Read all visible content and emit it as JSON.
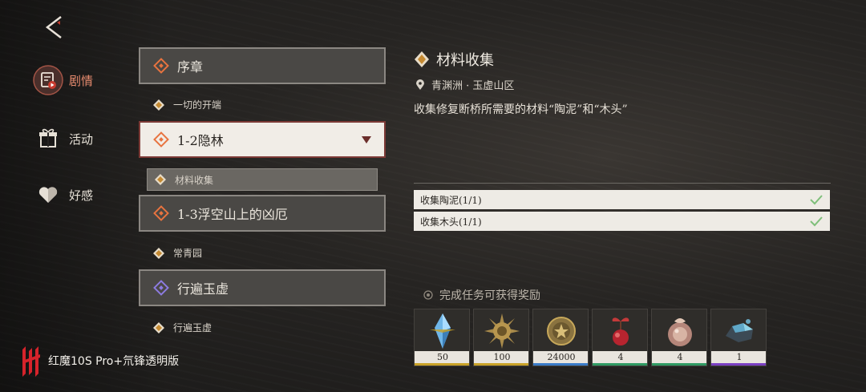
{
  "nav": [
    {
      "label": "剧情",
      "icon": "story-icon",
      "active": true
    },
    {
      "label": "活动",
      "icon": "gift-icon",
      "active": false
    },
    {
      "label": "好感",
      "icon": "heart-icon",
      "active": false
    }
  ],
  "chapters": [
    {
      "title": "序章",
      "sub": "一切的开端"
    },
    {
      "title": "1-2隐林",
      "sub": "材料收集"
    },
    {
      "title": "1-3浮空山上的凶厄",
      "sub": "常青园"
    },
    {
      "title": "行遍玉虚",
      "sub": "行遍玉虚"
    }
  ],
  "quest": {
    "title": "材料收集",
    "location": "青渊洲 · 玉虚山区",
    "description": "收集修复断桥所需要的材料“陶泥”和“木头”",
    "objectives": [
      {
        "text": "收集陶泥(1/1)",
        "done": true
      },
      {
        "text": "收集木头(1/1)",
        "done": true
      }
    ]
  },
  "rewards": {
    "header": "完成任务可获得奖励",
    "items": [
      {
        "icon": "crystal-icon",
        "count": "50",
        "rarity_color": "#c9a227"
      },
      {
        "icon": "spiked-sun-icon",
        "count": "100",
        "rarity_color": "#c9a227"
      },
      {
        "icon": "coin-icon",
        "count": "24000",
        "rarity_color": "#3a7bc8"
      },
      {
        "icon": "berry-icon",
        "count": "4",
        "rarity_color": "#2f9a63"
      },
      {
        "icon": "ornament-icon",
        "count": "4",
        "rarity_color": "#2f9a63"
      },
      {
        "icon": "ore-icon",
        "count": "1",
        "rarity_color": "#7b3fc2"
      }
    ]
  },
  "watermark": "红魔10S Pro+氘锋透明版",
  "colors": {
    "accent": "#e58a6e",
    "selected_border": "#7d3a36",
    "check": "#7fbf7a"
  }
}
